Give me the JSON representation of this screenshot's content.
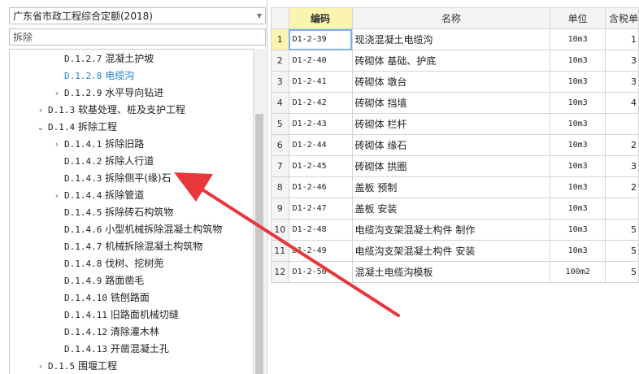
{
  "quota_select": {
    "value": "广东省市政工程综合定额(2018)"
  },
  "search": {
    "value": "拆除"
  },
  "tree": [
    {
      "code": "D.1.2.7",
      "label": "混凝土护坡",
      "chevron": ""
    },
    {
      "code": "D.1.2.8",
      "label": "电缆沟",
      "chevron": "",
      "active": true
    },
    {
      "code": "D.1.2.9",
      "label": "水平导向钻进",
      "chevron": "›"
    },
    {
      "code": "D.1.3",
      "label": "软基处理、桩及支护工程",
      "chevron": "›"
    },
    {
      "code": "D.1.4",
      "label": "拆除工程",
      "chevron": "⌄"
    },
    {
      "code": "D.1.4.1",
      "label": "拆除旧路",
      "chevron": "›"
    },
    {
      "code": "D.1.4.2",
      "label": "拆除人行道",
      "chevron": ""
    },
    {
      "code": "D.1.4.3",
      "label": "拆除侧平(缘)石",
      "chevron": ""
    },
    {
      "code": "D.1.4.4",
      "label": "拆除管道",
      "chevron": "›"
    },
    {
      "code": "D.1.4.5",
      "label": "拆除砖石构筑物",
      "chevron": ""
    },
    {
      "code": "D.1.4.6",
      "label": "小型机械拆除混凝土构筑物",
      "chevron": ""
    },
    {
      "code": "D.1.4.7",
      "label": "机械拆除混凝土构筑物",
      "chevron": ""
    },
    {
      "code": "D.1.4.8",
      "label": "伐树、挖树蔸",
      "chevron": ""
    },
    {
      "code": "D.1.4.9",
      "label": "路面凿毛",
      "chevron": ""
    },
    {
      "code": "D.1.4.10",
      "label": "铣刨路面",
      "chevron": ""
    },
    {
      "code": "D.1.4.11",
      "label": "旧路面机械切缝",
      "chevron": ""
    },
    {
      "code": "D.1.4.12",
      "label": "清除灌木林",
      "chevron": ""
    },
    {
      "code": "D.1.4.13",
      "label": "开凿混凝土孔",
      "chevron": ""
    },
    {
      "code": "D.1.5",
      "label": "围堰工程",
      "chevron": "›"
    }
  ],
  "table": {
    "headers": {
      "code": "编码",
      "name": "名称",
      "unit": "单位",
      "price": "含税单"
    },
    "rows": [
      {
        "no": "1",
        "code": "D1-2-39",
        "name": "现浇混凝土电缆沟",
        "unit": "10m3",
        "price": "1"
      },
      {
        "no": "2",
        "code": "D1-2-40",
        "name": "砖砌体 基础、护底",
        "unit": "10m3",
        "price": "3"
      },
      {
        "no": "3",
        "code": "D1-2-41",
        "name": "砖砌体 墩台",
        "unit": "10m3",
        "price": "3"
      },
      {
        "no": "4",
        "code": "D1-2-42",
        "name": "砖砌体 挡墙",
        "unit": "10m3",
        "price": "4"
      },
      {
        "no": "5",
        "code": "D1-2-43",
        "name": "砖砌体 栏杆",
        "unit": "10m3",
        "price": ""
      },
      {
        "no": "6",
        "code": "D1-2-44",
        "name": "砖砌体 缘石",
        "unit": "10m3",
        "price": "2"
      },
      {
        "no": "7",
        "code": "D1-2-45",
        "name": "砖砌体 拱圈",
        "unit": "10m3",
        "price": "3"
      },
      {
        "no": "8",
        "code": "D1-2-46",
        "name": "盖板 预制",
        "unit": "10m3",
        "price": "2"
      },
      {
        "no": "9",
        "code": "D1-2-47",
        "name": "盖板 安装",
        "unit": "10m3",
        "price": ""
      },
      {
        "no": "10",
        "code": "D1-2-48",
        "name": "电缆沟支架混凝土构件 制作",
        "unit": "10m3",
        "price": "5"
      },
      {
        "no": "11",
        "code": "D1-2-49",
        "name": "电缆沟支架混凝土构件 安装",
        "unit": "10m3",
        "price": "5"
      },
      {
        "no": "12",
        "code": "D1-2-50",
        "name": "混凝土电缆沟模板",
        "unit": "100m2",
        "price": "5"
      }
    ]
  },
  "colors": {
    "active_item": "#1f7fd6",
    "selected_header": "#fbf3b0",
    "annotation_arrow": "#e8363b"
  }
}
